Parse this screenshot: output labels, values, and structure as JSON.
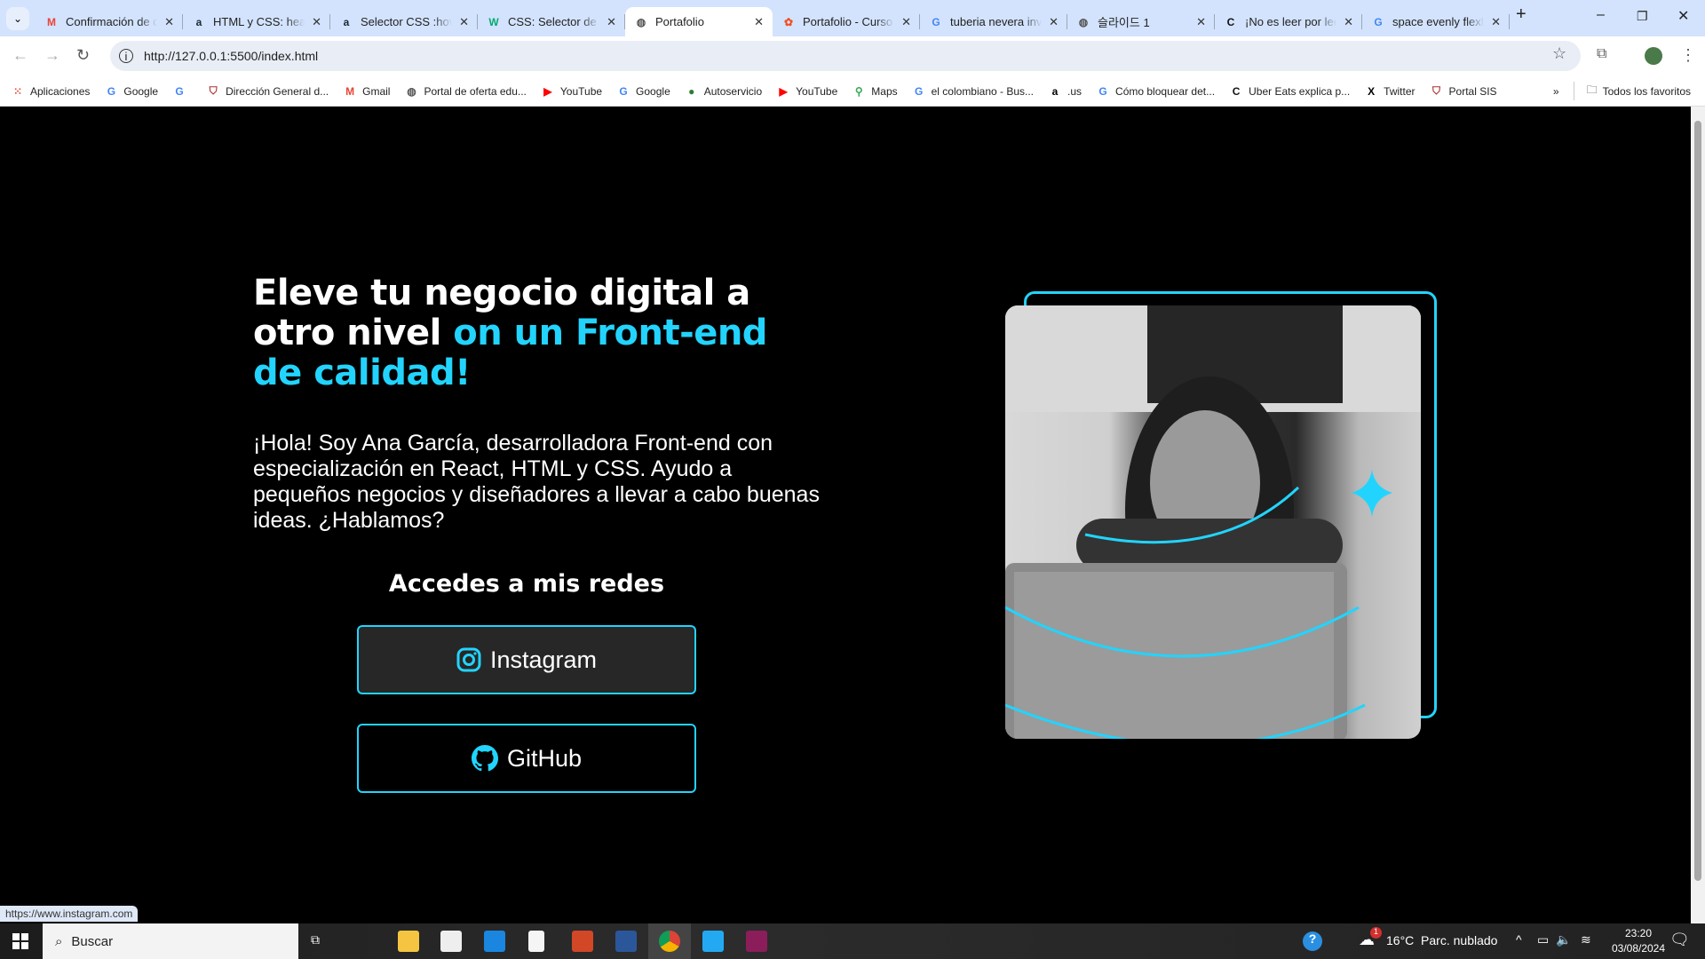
{
  "browser": {
    "tabs": [
      {
        "title": "Confirmación de c",
        "icon": "gmail-icon",
        "color": "#ea4335"
      },
      {
        "title": "HTML y CSS: head",
        "icon": "alura-icon",
        "color": "#1c2732"
      },
      {
        "title": "Selector CSS :hove",
        "icon": "alura-icon",
        "color": "#1c2732"
      },
      {
        "title": "CSS: Selector de p",
        "icon": "w3schools-icon",
        "color": "#04aa6d"
      },
      {
        "title": "Portafolio",
        "icon": "globe-icon",
        "color": "#555555",
        "active": true
      },
      {
        "title": "Portafolio - Curso",
        "icon": "figma-icon",
        "color": "#f24e1e"
      },
      {
        "title": "tuberia nevera inv",
        "icon": "google-icon",
        "color": "#4285f4"
      },
      {
        "title": "슬라이드 1",
        "icon": "globe-icon",
        "color": "#555555"
      },
      {
        "title": "¡No es leer por lee",
        "icon": "c-icon",
        "color": "#111111"
      },
      {
        "title": "space evenly flexb",
        "icon": "google-icon",
        "color": "#4285f4"
      }
    ],
    "url": "http://127.0.0.1:5500/index.html",
    "bookmarks": [
      {
        "label": "Aplicaciones",
        "icon": "apps-grid-icon"
      },
      {
        "label": "Google",
        "icon": "google-icon"
      },
      {
        "label": "",
        "icon": "google-icon"
      },
      {
        "label": "Dirección General d...",
        "icon": "shield-icon"
      },
      {
        "label": "Gmail",
        "icon": "gmail-icon"
      },
      {
        "label": "Portal de oferta edu...",
        "icon": "globe-icon"
      },
      {
        "label": "YouTube",
        "icon": "youtube-icon"
      },
      {
        "label": "Google",
        "icon": "google-icon"
      },
      {
        "label": "Autoservicio",
        "icon": "autoservicio-icon"
      },
      {
        "label": "YouTube",
        "icon": "youtube-icon"
      },
      {
        "label": "Maps",
        "icon": "maps-icon"
      },
      {
        "label": "el colombiano - Bus...",
        "icon": "google-icon"
      },
      {
        "label": ".us",
        "icon": "amazon-icon"
      },
      {
        "label": "Cómo bloquear det...",
        "icon": "google-icon"
      },
      {
        "label": "Uber Eats explica p...",
        "icon": "c-icon"
      },
      {
        "label": "Twitter",
        "icon": "x-icon"
      },
      {
        "label": "Portal SIS",
        "icon": "shield-icon"
      }
    ],
    "all_bookmarks": "Todos los favoritos",
    "status_url": "https://www.instagram.com"
  },
  "page": {
    "title_white": "Eleve tu negocio digital a otro nivel ",
    "title_accent": "on un Front-end de calidad!",
    "intro": "¡Hola! Soy Ana García, desarrolladora Front-end con especialización en React, HTML y CSS. Ayudo a pequeños negocios y diseñadores a llevar a cabo buenas ideas. ¿Hablamos?",
    "socials_heading": "Accedes a mis redes",
    "instagram": "Instagram",
    "github": "GitHub",
    "accent_color": "#22d4fd"
  },
  "taskbar": {
    "search": "Buscar",
    "weather": "16°C  Parc. nublado",
    "time": "23:20",
    "date": "03/08/2024",
    "weather_badge": "1"
  }
}
